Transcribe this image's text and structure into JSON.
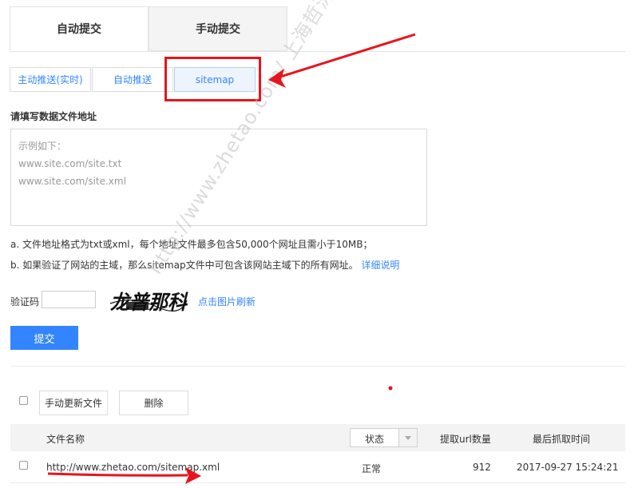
{
  "top_tabs": [
    {
      "label": "自动提交",
      "active": true
    },
    {
      "label": "手动提交",
      "active": false
    }
  ],
  "sub_tabs": [
    {
      "label": "主动推送(实时)",
      "active": false
    },
    {
      "label": "自动推送",
      "active": false
    },
    {
      "label": "sitemap",
      "active": true
    }
  ],
  "form": {
    "section_title": "请填写数据文件地址",
    "textarea_placeholder": "示例如下：\nwww.site.com/site.txt\nwww.site.com/site.xml",
    "note_a": "a. 文件地址格式为txt或xml，每个地址文件最多包含50,000个网址且需小于10MB；",
    "note_b": "b. 如果验证了网站的主域，那么sitemap文件中可包含该网站主域下的所有网址。",
    "note_b_link": "详细说明",
    "captcha_label": "验证码",
    "captcha_value": "",
    "captcha_text": "龙普那科",
    "refresh_link": "点击图片刷新",
    "submit_label": "提交"
  },
  "table": {
    "toolbar": {
      "update_label": "手动更新文件",
      "delete_label": "删除"
    },
    "headers": {
      "file_name": "文件名称",
      "status": "状态",
      "url_count": "提取url数量",
      "last_crawl": "最后抓取时间"
    },
    "rows": [
      {
        "file_name": "http://www.zhetao.com/sitemap.xml",
        "status": "正常",
        "url_count": "912",
        "last_crawl": "2017-09-27 15:24:21"
      }
    ]
  },
  "watermark": "http://www.zhetao.com/ 上海哲涛版权所有",
  "colors": {
    "accent": "#3385ff",
    "annotation": "#e8141c"
  }
}
